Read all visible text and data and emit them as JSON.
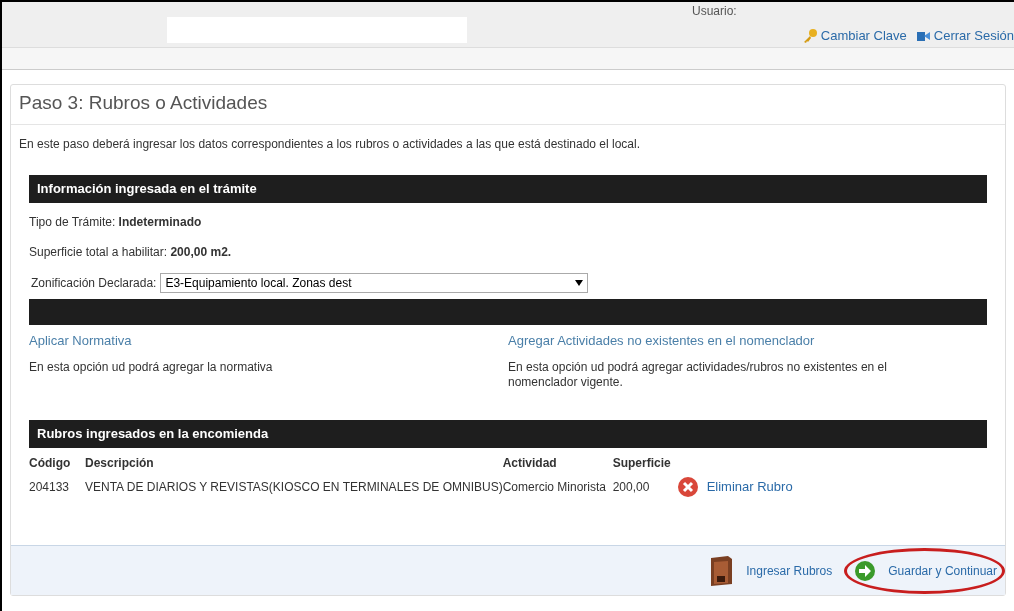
{
  "header": {
    "user_label": "Usuario:",
    "links": [
      {
        "kind": "key",
        "label": "Cambiar Clave"
      },
      {
        "kind": "logout",
        "label": "Cerrar Sesión"
      }
    ]
  },
  "page": {
    "title": "Paso 3: Rubros o Actividades",
    "intro": "En este paso deberá ingresar los datos correspondientes a los rubros o actividades a las que está destinado el local."
  },
  "info": {
    "heading": "Información ingresada en el trámite",
    "tipo_label": "Tipo de Trámite:",
    "tipo_value": "Indeterminado",
    "superficie_label": "Superficie total a habilitar:",
    "superficie_value": "200,00 m2.",
    "zonificacion_label": "Zonificación Declarada:",
    "zonificacion_value": "E3-Equipamiento local. Zonas dest"
  },
  "options": [
    {
      "link": "Aplicar Normativa",
      "description": "En esta opción ud podrá agregar la normativa"
    },
    {
      "link": "Agregar Actividades no existentes en el nomenclador",
      "description": "En esta opción ud podrá agregar actividades/rubros no existentes en el nomenclador vigente."
    }
  ],
  "rubros": {
    "heading": "Rubros ingresados en la encomienda",
    "columns": [
      "Código",
      "Descripción",
      "Actividad",
      "Superficie"
    ],
    "rows": [
      {
        "codigo": "204133",
        "descripcion": "VENTA DE DIARIOS Y REVISTAS(KIOSCO EN TERMINALES DE OMNIBUS)",
        "actividad": "Comercio Minorista",
        "superficie": "200,00",
        "action": "Eliminar Rubro"
      }
    ]
  },
  "footer_buttons": [
    {
      "kind": "rubros",
      "label": "Ingresar Rubros",
      "circled": false
    },
    {
      "kind": "next",
      "label": "Guardar y Continuar",
      "circled": true
    }
  ]
}
